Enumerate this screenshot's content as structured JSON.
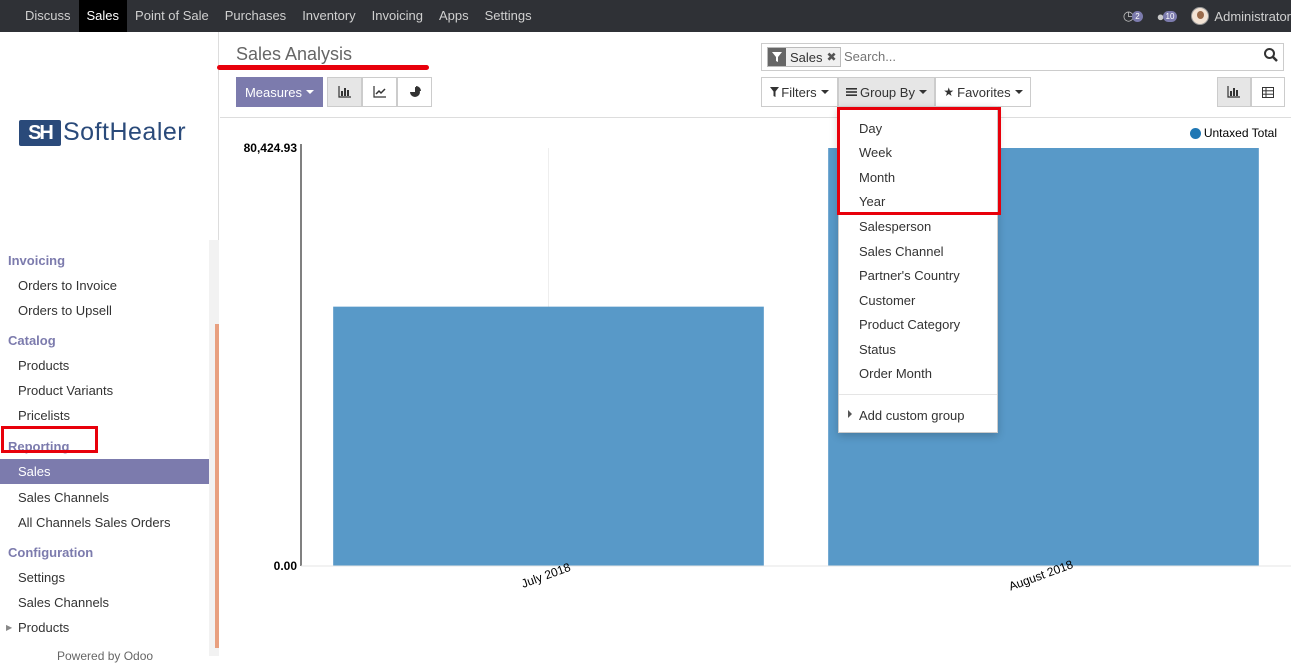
{
  "topbar": {
    "apps": [
      "Discuss",
      "Sales",
      "Point of Sale",
      "Purchases",
      "Inventory",
      "Invoicing",
      "Apps",
      "Settings"
    ],
    "active_app": "Sales",
    "activity_count": "2",
    "messages_count": "10",
    "user": "Administrator"
  },
  "logo": {
    "mark": "SH",
    "text": "SoftHealer"
  },
  "sidebar": {
    "invoicing": {
      "title": "Invoicing",
      "items": [
        "Orders to Invoice",
        "Orders to Upsell"
      ]
    },
    "catalog": {
      "title": "Catalog",
      "items": [
        "Products",
        "Product Variants",
        "Pricelists"
      ]
    },
    "reporting": {
      "title": "Reporting",
      "items": [
        "Sales",
        "Sales Channels",
        "All Channels Sales Orders"
      ]
    },
    "configuration": {
      "title": "Configuration",
      "items": [
        "Settings",
        "Sales Channels",
        "Products"
      ]
    },
    "powered": "Powered by Odoo"
  },
  "page": {
    "title": "Sales Analysis"
  },
  "toolbar": {
    "measures": "Measures",
    "filters": "Filters",
    "group_by": "Group By",
    "favorites": "Favorites"
  },
  "search": {
    "facet": "Sales",
    "placeholder": "Search..."
  },
  "group_by_menu": {
    "options": [
      "Day",
      "Week",
      "Month",
      "Year",
      "Salesperson",
      "Sales Channel",
      "Partner's Country",
      "Customer",
      "Product Category",
      "Status",
      "Order Month"
    ],
    "custom": "Add custom group"
  },
  "colors": {
    "accent": "#7c7bad",
    "bar": "#5899c8",
    "highlight": "#e8000b"
  },
  "chart_data": {
    "type": "bar",
    "categories": [
      "July 2018",
      "August 2018"
    ],
    "series": [
      {
        "name": "Untaxed Total",
        "values": [
          49900,
          80424.93
        ]
      }
    ],
    "ytick_labels": [
      "80,424.93",
      "0.00"
    ],
    "ylim": [
      0,
      80424.93
    ],
    "legend": "top-right"
  }
}
